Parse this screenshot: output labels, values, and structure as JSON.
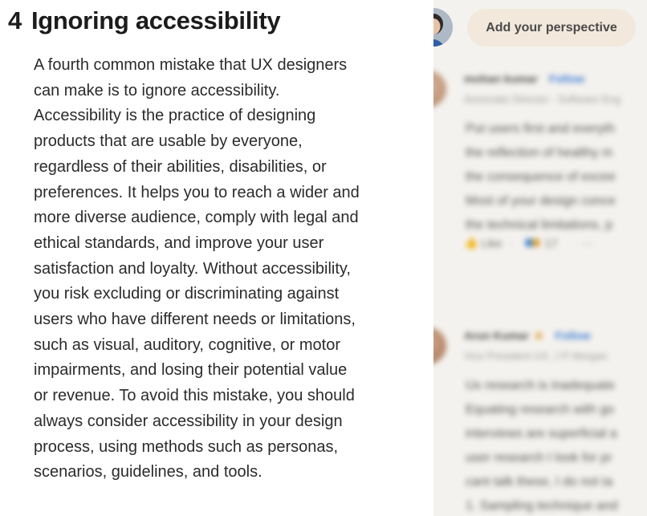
{
  "article": {
    "section_number": "4",
    "section_title": "Ignoring accessibility",
    "body": "A fourth common mistake that UX designers can make is to ignore accessibility. Accessibility is the practice of designing products that are usable by everyone, regardless of their abilities, disabilities, or preferences. It helps you to reach a wider and more diverse audience, comply with legal and ethical standards, and improve your user satisfaction and loyalty. Without accessibility, you risk excluding or discriminating against users who have different needs or limitations, such as visual, auditory, cognitive, or motor impairments, and losing their potential value or revenue. To avoid this mistake, you should always consider accessibility in your design process, using methods such as personas, scenarios, guidelines, and tools."
  },
  "sidebar": {
    "add_perspective_label": "Add your perspective",
    "comments": [
      {
        "name": "mohan kumar",
        "follow": "Follow",
        "badge": "",
        "headline": "Associate Director - Software Eng",
        "lines": [
          "Put users first and everyth",
          "the reflection of healthy m",
          "the consequence of excee",
          "Most of your design conce",
          "the technical limitations, p"
        ],
        "like_label": "Like",
        "reaction_count": "17",
        "more": "···"
      },
      {
        "name": "Arun Kumar",
        "follow": "Follow",
        "badge": "★",
        "headline": "Vice President UX, J P Morgan",
        "lines": [
          " Ux research is inadequate",
          "Equating research with go",
          "interviews are superficial a",
          "user research I look for pr",
          "cant talk these, I do not ta",
          "1.  Sampling technique and"
        ]
      }
    ]
  },
  "colors": {
    "article_bg": "#ffffff",
    "sidebar_bg": "#f4f2ee",
    "button_bg": "#f2e9dc",
    "link_blue": "#3a7bd5"
  }
}
